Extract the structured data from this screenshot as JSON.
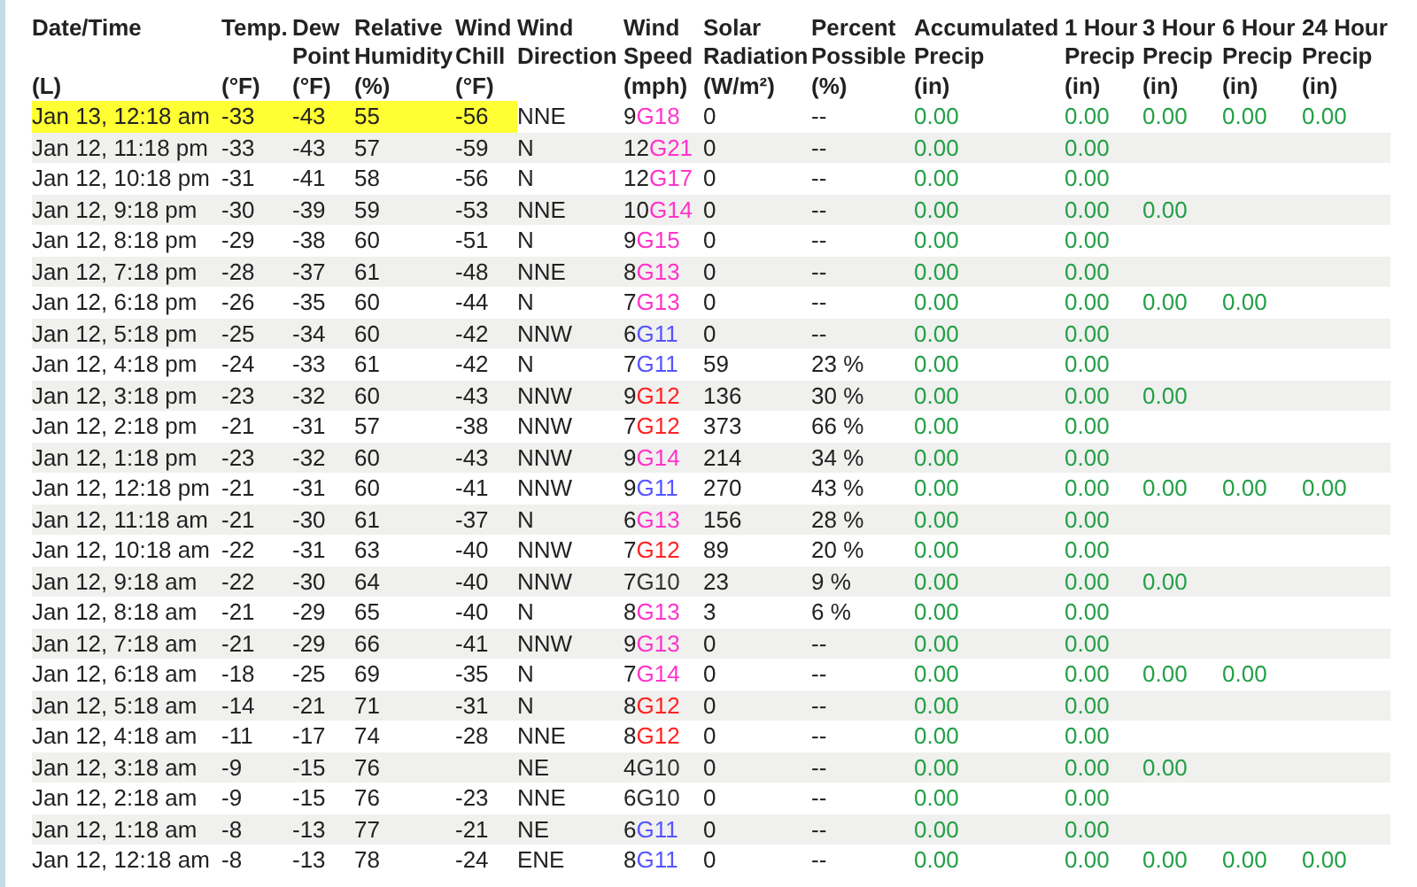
{
  "columns": [
    {
      "title": [
        "Date/Time"
      ],
      "unit": "(L)"
    },
    {
      "title": [
        "Temp."
      ],
      "unit": "(°F)"
    },
    {
      "title": [
        "Dew",
        "Point"
      ],
      "unit": "(°F)"
    },
    {
      "title": [
        "Relative",
        "Humidity"
      ],
      "unit": "(%)"
    },
    {
      "title": [
        "Wind",
        "Chill"
      ],
      "unit": "(°F)"
    },
    {
      "title": [
        "Wind",
        "Direction"
      ]
    },
    {
      "title": [
        "Wind",
        "Speed"
      ],
      "unit": "(mph)"
    },
    {
      "title": [
        "Solar",
        "Radiation"
      ],
      "unit": "(W/m²)"
    },
    {
      "title": [
        "Percent",
        "Possible"
      ],
      "unit": "(%)"
    },
    {
      "title": [
        "Accumulated",
        "Precip"
      ],
      "unit": "(in)"
    },
    {
      "title": [
        "1 Hour",
        "Precip"
      ],
      "unit": "(in)"
    },
    {
      "title": [
        "3 Hour",
        "Precip"
      ],
      "unit": "(in)"
    },
    {
      "title": [
        "6 Hour",
        "Precip"
      ],
      "unit": "(in)"
    },
    {
      "title": [
        "24 Hour",
        "Precip"
      ],
      "unit": "(in)"
    }
  ],
  "rows": [
    {
      "highlighted": true,
      "time": "Jan 13, 12:18 am",
      "temp": "-33",
      "dew": "-43",
      "rh": "55",
      "chill": "-56",
      "dir": "NNE",
      "speed": "9",
      "gust": "G18",
      "color": "#ff33cc",
      "solar": "0",
      "pct": "--",
      "accum": "0.00",
      "precip": [
        "0.00",
        "0.00",
        "0.00",
        "0.00"
      ]
    },
    {
      "highlighted": false,
      "time": "Jan 12, 11:18 pm",
      "temp": "-33",
      "dew": "-43",
      "rh": "57",
      "chill": "-59",
      "dir": "N",
      "speed": "12",
      "gust": "G21",
      "color": "#ff33cc",
      "solar": "0",
      "pct": "--",
      "accum": "0.00",
      "precip": [
        "0.00"
      ]
    },
    {
      "highlighted": false,
      "time": "Jan 12, 10:18 pm",
      "temp": "-31",
      "dew": "-41",
      "rh": "58",
      "chill": "-56",
      "dir": "N",
      "speed": "12",
      "gust": "G17",
      "color": "#ff33cc",
      "solar": "0",
      "pct": "--",
      "accum": "0.00",
      "precip": [
        "0.00"
      ]
    },
    {
      "highlighted": false,
      "time": "Jan 12, 9:18 pm",
      "temp": "-30",
      "dew": "-39",
      "rh": "59",
      "chill": "-53",
      "dir": "NNE",
      "speed": "10",
      "gust": "G14",
      "color": "#ff33cc",
      "solar": "0",
      "pct": "--",
      "accum": "0.00",
      "precip": [
        "0.00",
        "0.00"
      ]
    },
    {
      "highlighted": false,
      "time": "Jan 12, 8:18 pm",
      "temp": "-29",
      "dew": "-38",
      "rh": "60",
      "chill": "-51",
      "dir": "N",
      "speed": "9",
      "gust": "G15",
      "color": "#ff33cc",
      "solar": "0",
      "pct": "--",
      "accum": "0.00",
      "precip": [
        "0.00"
      ]
    },
    {
      "highlighted": false,
      "time": "Jan 12, 7:18 pm",
      "temp": "-28",
      "dew": "-37",
      "rh": "61",
      "chill": "-48",
      "dir": "NNE",
      "speed": "8",
      "gust": "G13",
      "color": "#ff33cc",
      "solar": "0",
      "pct": "--",
      "accum": "0.00",
      "precip": [
        "0.00"
      ]
    },
    {
      "highlighted": false,
      "time": "Jan 12, 6:18 pm",
      "temp": "-26",
      "dew": "-35",
      "rh": "60",
      "chill": "-44",
      "dir": "N",
      "speed": "7",
      "gust": "G13",
      "color": "#ff33cc",
      "solar": "0",
      "pct": "--",
      "accum": "0.00",
      "precip": [
        "0.00",
        "0.00",
        "0.00"
      ]
    },
    {
      "highlighted": false,
      "time": "Jan 12, 5:18 pm",
      "temp": "-25",
      "dew": "-34",
      "rh": "60",
      "chill": "-42",
      "dir": "NNW",
      "speed": "6",
      "gust": "G11",
      "color": "#5555ff",
      "solar": "0",
      "pct": "--",
      "accum": "0.00",
      "precip": [
        "0.00"
      ]
    },
    {
      "highlighted": false,
      "time": "Jan 12, 4:18 pm",
      "temp": "-24",
      "dew": "-33",
      "rh": "61",
      "chill": "-42",
      "dir": "N",
      "speed": "7",
      "gust": "G11",
      "color": "#5555ff",
      "solar": "59",
      "pct": "23 %",
      "accum": "0.00",
      "precip": [
        "0.00"
      ]
    },
    {
      "highlighted": false,
      "time": "Jan 12, 3:18 pm",
      "temp": "-23",
      "dew": "-32",
      "rh": "60",
      "chill": "-43",
      "dir": "NNW",
      "speed": "9",
      "gust": "G12",
      "color": "#ff2222",
      "solar": "136",
      "pct": "30 %",
      "accum": "0.00",
      "precip": [
        "0.00",
        "0.00"
      ]
    },
    {
      "highlighted": false,
      "time": "Jan 12, 2:18 pm",
      "temp": "-21",
      "dew": "-31",
      "rh": "57",
      "chill": "-38",
      "dir": "NNW",
      "speed": "7",
      "gust": "G12",
      "color": "#ff2222",
      "solar": "373",
      "pct": "66 %",
      "accum": "0.00",
      "precip": [
        "0.00"
      ]
    },
    {
      "highlighted": false,
      "time": "Jan 12, 1:18 pm",
      "temp": "-23",
      "dew": "-32",
      "rh": "60",
      "chill": "-43",
      "dir": "NNW",
      "speed": "9",
      "gust": "G14",
      "color": "#ff33cc",
      "solar": "214",
      "pct": "34 %",
      "accum": "0.00",
      "precip": [
        "0.00"
      ]
    },
    {
      "highlighted": false,
      "time": "Jan 12, 12:18 pm",
      "temp": "-21",
      "dew": "-31",
      "rh": "60",
      "chill": "-41",
      "dir": "NNW",
      "speed": "9",
      "gust": "G11",
      "color": "#5555ff",
      "solar": "270",
      "pct": "43 %",
      "accum": "0.00",
      "precip": [
        "0.00",
        "0.00",
        "0.00",
        "0.00"
      ]
    },
    {
      "highlighted": false,
      "time": "Jan 12, 11:18 am",
      "temp": "-21",
      "dew": "-30",
      "rh": "61",
      "chill": "-37",
      "dir": "N",
      "speed": "6",
      "gust": "G13",
      "color": "#ff33cc",
      "solar": "156",
      "pct": "28 %",
      "accum": "0.00",
      "precip": [
        "0.00"
      ]
    },
    {
      "highlighted": false,
      "time": "Jan 12, 10:18 am",
      "temp": "-22",
      "dew": "-31",
      "rh": "63",
      "chill": "-40",
      "dir": "NNW",
      "speed": "7",
      "gust": "G12",
      "color": "#ff2222",
      "solar": "89",
      "pct": "20 %",
      "accum": "0.00",
      "precip": [
        "0.00"
      ]
    },
    {
      "highlighted": false,
      "time": "Jan 12, 9:18 am",
      "temp": "-22",
      "dew": "-30",
      "rh": "64",
      "chill": "-40",
      "dir": "NNW",
      "speed": "7",
      "gust": "G10",
      "color": "#333333",
      "solar": "23",
      "pct": "9 %",
      "accum": "0.00",
      "precip": [
        "0.00",
        "0.00"
      ]
    },
    {
      "highlighted": false,
      "time": "Jan 12, 8:18 am",
      "temp": "-21",
      "dew": "-29",
      "rh": "65",
      "chill": "-40",
      "dir": "N",
      "speed": "8",
      "gust": "G13",
      "color": "#ff33cc",
      "solar": "3",
      "pct": "6 %",
      "accum": "0.00",
      "precip": [
        "0.00"
      ]
    },
    {
      "highlighted": false,
      "time": "Jan 12, 7:18 am",
      "temp": "-21",
      "dew": "-29",
      "rh": "66",
      "chill": "-41",
      "dir": "NNW",
      "speed": "9",
      "gust": "G13",
      "color": "#ff33cc",
      "solar": "0",
      "pct": "--",
      "accum": "0.00",
      "precip": [
        "0.00"
      ]
    },
    {
      "highlighted": false,
      "time": "Jan 12, 6:18 am",
      "temp": "-18",
      "dew": "-25",
      "rh": "69",
      "chill": "-35",
      "dir": "N",
      "speed": "7",
      "gust": "G14",
      "color": "#ff33cc",
      "solar": "0",
      "pct": "--",
      "accum": "0.00",
      "precip": [
        "0.00",
        "0.00",
        "0.00"
      ]
    },
    {
      "highlighted": false,
      "time": "Jan 12, 5:18 am",
      "temp": "-14",
      "dew": "-21",
      "rh": "71",
      "chill": "-31",
      "dir": "N",
      "speed": "8",
      "gust": "G12",
      "color": "#ff2222",
      "solar": "0",
      "pct": "--",
      "accum": "0.00",
      "precip": [
        "0.00"
      ]
    },
    {
      "highlighted": false,
      "time": "Jan 12, 4:18 am",
      "temp": "-11",
      "dew": "-17",
      "rh": "74",
      "chill": "-28",
      "dir": "NNE",
      "speed": "8",
      "gust": "G12",
      "color": "#ff2222",
      "solar": "0",
      "pct": "--",
      "accum": "0.00",
      "precip": [
        "0.00"
      ]
    },
    {
      "highlighted": false,
      "time": "Jan 12, 3:18 am",
      "temp": "-9",
      "dew": "-15",
      "rh": "76",
      "dir": "NE",
      "speed": "4",
      "gust": "G10",
      "color": "#333333",
      "solar": "0",
      "pct": "--",
      "accum": "0.00",
      "precip": [
        "0.00",
        "0.00"
      ]
    },
    {
      "highlighted": false,
      "time": "Jan 12, 2:18 am",
      "temp": "-9",
      "dew": "-15",
      "rh": "76",
      "chill": "-23",
      "dir": "NNE",
      "speed": "6",
      "gust": "G10",
      "color": "#333333",
      "solar": "0",
      "pct": "--",
      "accum": "0.00",
      "precip": [
        "0.00"
      ]
    },
    {
      "highlighted": false,
      "time": "Jan 12, 1:18 am",
      "temp": "-8",
      "dew": "-13",
      "rh": "77",
      "chill": "-21",
      "dir": "NE",
      "speed": "6",
      "gust": "G11",
      "color": "#5555ff",
      "solar": "0",
      "pct": "--",
      "accum": "0.00",
      "precip": [
        "0.00"
      ]
    },
    {
      "highlighted": false,
      "time": "Jan 12, 12:18 am",
      "temp": "-8",
      "dew": "-13",
      "rh": "78",
      "chill": "-24",
      "dir": "ENE",
      "speed": "8",
      "gust": "G11",
      "color": "#5555ff",
      "solar": "0",
      "pct": "--",
      "accum": "0.00",
      "precip": [
        "0.00",
        "0.00",
        "0.00",
        "0.00"
      ]
    }
  ]
}
